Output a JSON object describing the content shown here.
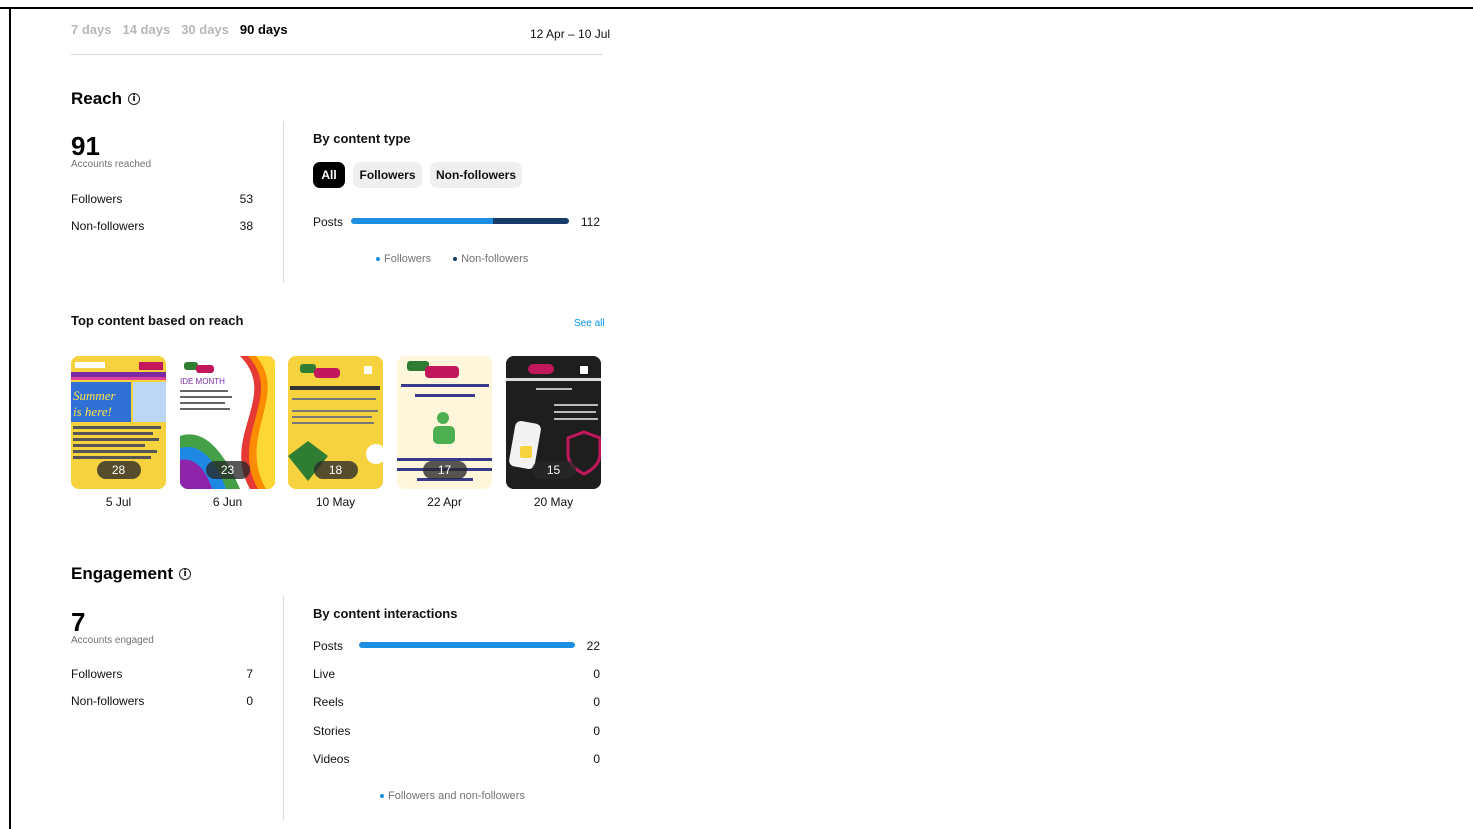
{
  "range": {
    "tabs": [
      "7 days",
      "14 days",
      "30 days",
      "90 days"
    ],
    "active_index": 3,
    "dates": "12 Apr – 10 Jul"
  },
  "reach": {
    "title": "Reach",
    "info_glyph": "i",
    "total": "91",
    "total_label": "Accounts reached",
    "rows": [
      {
        "label": "Followers",
        "value": "53"
      },
      {
        "label": "Non-followers",
        "value": "38"
      }
    ],
    "by_content_type": {
      "title": "By content type",
      "filters": [
        "All",
        "Followers",
        "Non-followers"
      ],
      "active_filter": 0,
      "bars": [
        {
          "label": "Posts",
          "value": "112",
          "followers_share": 0.65,
          "non_followers_share": 0.35
        }
      ],
      "legend": [
        {
          "label": "Followers",
          "color": "#1c8fe3"
        },
        {
          "label": "Non-followers",
          "color": "#173a6b"
        }
      ]
    }
  },
  "top_content": {
    "title": "Top content based on reach",
    "see_all": "See all",
    "items": [
      {
        "count": "28",
        "date": "5 Jul",
        "thumb": "summer-flyer",
        "bg": "#f6d23f"
      },
      {
        "count": "23",
        "date": "6 Jun",
        "thumb": "pride-month-rainbow",
        "bg": "#ffffff"
      },
      {
        "count": "18",
        "date": "10 May",
        "thumb": "staying-safe-online",
        "bg": "#f6d23f"
      },
      {
        "count": "17",
        "date": "22 Apr",
        "thumb": "bereavement-film",
        "bg": "#fff6dc"
      },
      {
        "count": "15",
        "date": "20 May",
        "thumb": "staying-safe-dark",
        "bg": "#1e1e1e"
      }
    ]
  },
  "engagement": {
    "title": "Engagement",
    "info_glyph": "i",
    "total": "7",
    "total_label": "Accounts engaged",
    "rows": [
      {
        "label": "Followers",
        "value": "7"
      },
      {
        "label": "Non-followers",
        "value": "0"
      }
    ],
    "by_interactions": {
      "title": "By content interactions",
      "bars": [
        {
          "label": "Posts",
          "value": "22",
          "share": 1
        },
        {
          "label": "Live",
          "value": "0",
          "share": 0
        },
        {
          "label": "Reels",
          "value": "0",
          "share": 0
        },
        {
          "label": "Stories",
          "value": "0",
          "share": 0
        },
        {
          "label": "Videos",
          "value": "0",
          "share": 0
        }
      ],
      "legend": [
        {
          "label": "Followers and non-followers",
          "color": "#1c8fe3"
        }
      ]
    }
  }
}
